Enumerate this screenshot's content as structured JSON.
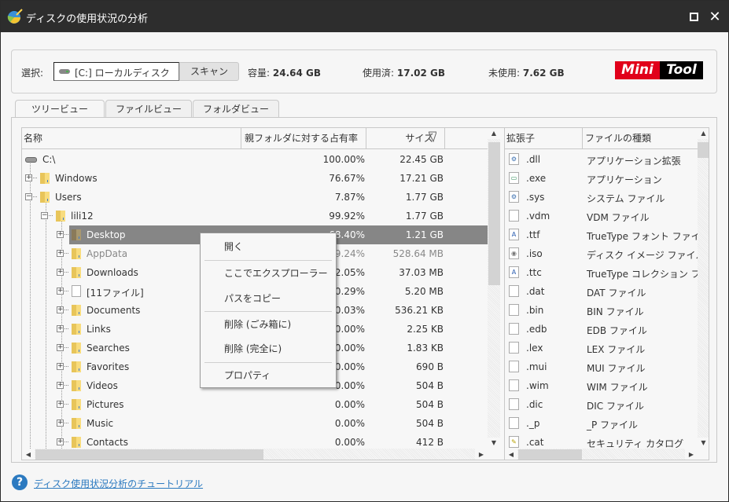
{
  "window": {
    "title": "ディスクの使用状況の分析",
    "maximize_icon": "maximize-icon",
    "close_icon": "close-icon"
  },
  "top": {
    "select_label": "選択:",
    "drive_value": "[C:] ローカルディスク",
    "scan_label": "スキャン",
    "capacity_label": "容量:",
    "capacity_value": "24.64 GB",
    "used_label": "使用済:",
    "used_value": "17.02 GB",
    "free_label": "未使用:",
    "free_value": "7.62 GB",
    "logo_left": "Mini",
    "logo_right": "Tool",
    "logo_red": "#e1001a"
  },
  "tabs": [
    {
      "label": "ツリービュー",
      "active": true
    },
    {
      "label": "ファイルビュー",
      "active": false
    },
    {
      "label": "フォルダビュー",
      "active": false
    }
  ],
  "tree": {
    "columns": {
      "name": "名称",
      "pct": "親フォルダに対する占有率",
      "size": "サイズ"
    },
    "rows": [
      {
        "name": "C:\\",
        "pct": "100.00%",
        "size": "22.45 GB",
        "level": 0,
        "icon": "drive",
        "expander": "none"
      },
      {
        "name": "Windows",
        "pct": "76.67%",
        "size": "17.21 GB",
        "level": 1,
        "icon": "folder",
        "expander": "plus"
      },
      {
        "name": "Users",
        "pct": "7.87%",
        "size": "1.77 GB",
        "level": 1,
        "icon": "folder",
        "expander": "minus"
      },
      {
        "name": "lili12",
        "pct": "99.92%",
        "size": "1.77 GB",
        "level": 2,
        "icon": "folder",
        "expander": "minus"
      },
      {
        "name": "Desktop",
        "pct": "68.40%",
        "size": "1.21 GB",
        "level": 3,
        "icon": "folder",
        "expander": "plus",
        "selected": true
      },
      {
        "name": "AppData",
        "pct": "29.24%",
        "size": "528.64 MB",
        "level": 3,
        "icon": "folder",
        "expander": "plus",
        "dim": true
      },
      {
        "name": "Downloads",
        "pct": "2.05%",
        "size": "37.03 MB",
        "level": 3,
        "icon": "folder",
        "expander": "plus"
      },
      {
        "name": "[11ファイル]",
        "pct": "0.29%",
        "size": "5.20 MB",
        "level": 3,
        "icon": "file",
        "expander": "plus"
      },
      {
        "name": "Documents",
        "pct": "0.03%",
        "size": "536.21 KB",
        "level": 3,
        "icon": "folder",
        "expander": "plus"
      },
      {
        "name": "Links",
        "pct": "0.00%",
        "size": "2.25 KB",
        "level": 3,
        "icon": "folder",
        "expander": "plus"
      },
      {
        "name": "Searches",
        "pct": "0.00%",
        "size": "1.83 KB",
        "level": 3,
        "icon": "folder",
        "expander": "plus"
      },
      {
        "name": "Favorites",
        "pct": "0.00%",
        "size": "690 B",
        "level": 3,
        "icon": "folder",
        "expander": "plus"
      },
      {
        "name": "Videos",
        "pct": "0.00%",
        "size": "504 B",
        "level": 3,
        "icon": "folder",
        "expander": "plus"
      },
      {
        "name": "Pictures",
        "pct": "0.00%",
        "size": "504 B",
        "level": 3,
        "icon": "folder",
        "expander": "plus"
      },
      {
        "name": "Music",
        "pct": "0.00%",
        "size": "504 B",
        "level": 3,
        "icon": "folder",
        "expander": "plus"
      },
      {
        "name": "Contacts",
        "pct": "0.00%",
        "size": "412 B",
        "level": 3,
        "icon": "folder",
        "expander": "plus"
      }
    ]
  },
  "context_menu": {
    "items": [
      {
        "label": "開く"
      },
      {
        "label": "ここでエクスプローラー"
      },
      {
        "label": "パスをコピー"
      },
      {
        "label": "削除 (ごみ箱に)"
      },
      {
        "label": "削除 (完全に)"
      },
      {
        "label": "プロパティ"
      }
    ]
  },
  "extensions": {
    "columns": {
      "ext": "拡張子",
      "type": "ファイルの種類"
    },
    "rows": [
      {
        "ext": ".dll",
        "type": "アプリケーション拡張",
        "icon": "dll-icon"
      },
      {
        "ext": ".exe",
        "type": "アプリケーション",
        "icon": "exe-icon"
      },
      {
        "ext": ".sys",
        "type": "システム ファイル",
        "icon": "sys-icon"
      },
      {
        "ext": ".vdm",
        "type": "VDM ファイル",
        "icon": "file-icon"
      },
      {
        "ext": ".ttf",
        "type": "TrueType フォント ファイル",
        "icon": "font-icon"
      },
      {
        "ext": ".iso",
        "type": "ディスク イメージ ファイル",
        "icon": "disc-image-icon"
      },
      {
        "ext": ".ttc",
        "type": "TrueType コレクション フォント",
        "icon": "font-icon"
      },
      {
        "ext": ".dat",
        "type": "DAT ファイル",
        "icon": "file-icon"
      },
      {
        "ext": ".bin",
        "type": "BIN ファイル",
        "icon": "file-icon"
      },
      {
        "ext": ".edb",
        "type": "EDB ファイル",
        "icon": "file-icon"
      },
      {
        "ext": ".lex",
        "type": "LEX ファイル",
        "icon": "file-icon"
      },
      {
        "ext": ".mui",
        "type": "MUI ファイル",
        "icon": "file-icon"
      },
      {
        "ext": ".wim",
        "type": "WIM ファイル",
        "icon": "file-icon"
      },
      {
        "ext": ".dic",
        "type": "DIC ファイル",
        "icon": "file-icon"
      },
      {
        "ext": "._p",
        "type": "_P ファイル",
        "icon": "file-icon"
      },
      {
        "ext": ".cat",
        "type": "セキュリティ カタログ",
        "icon": "catalog-icon"
      }
    ]
  },
  "footer": {
    "help_link": "ディスク使用状況分析のチュートリアル"
  }
}
